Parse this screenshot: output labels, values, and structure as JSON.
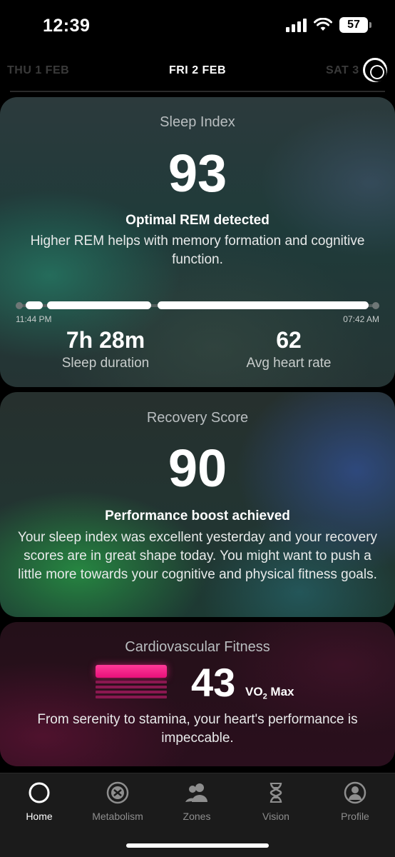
{
  "status": {
    "time": "12:39",
    "battery": "57"
  },
  "dates": {
    "prev": "THU 1 FEB",
    "current": "FRI 2 FEB",
    "next": "SAT 3"
  },
  "sleep": {
    "title": "Sleep Index",
    "score": "93",
    "headline": "Optimal REM detected",
    "body": "Higher REM helps with memory formation and cognitive function.",
    "start_time": "11:44 PM",
    "end_time": "07:42 AM",
    "duration_value": "7h 28m",
    "duration_label": "Sleep duration",
    "heart_value": "62",
    "heart_label": "Avg heart rate"
  },
  "recovery": {
    "title": "Recovery Score",
    "score": "90",
    "headline": "Performance boost achieved",
    "body": "Your sleep index was excellent yesterday and your recovery scores are in great shape today. You might want to push a little more towards your cognitive and physical fitness goals."
  },
  "cardio": {
    "title": "Cardiovascular Fitness",
    "value": "43",
    "unit_main": "VO",
    "unit_sub": "2",
    "unit_suffix": " Max",
    "body": "From serenity to stamina, your heart's performance is impeccable."
  },
  "tabs": [
    {
      "label": "Home",
      "icon": "home-ring-icon",
      "active": true
    },
    {
      "label": "Metabolism",
      "icon": "metabolism-icon",
      "active": false
    },
    {
      "label": "Zones",
      "icon": "zones-people-icon",
      "active": false
    },
    {
      "label": "Vision",
      "icon": "vision-dna-icon",
      "active": false
    },
    {
      "label": "Profile",
      "icon": "profile-icon",
      "active": false
    }
  ],
  "colors": {
    "accent_pink": "#ff2e90",
    "tab_active": "#ffffff",
    "tab_inactive": "#8e8e8e"
  }
}
